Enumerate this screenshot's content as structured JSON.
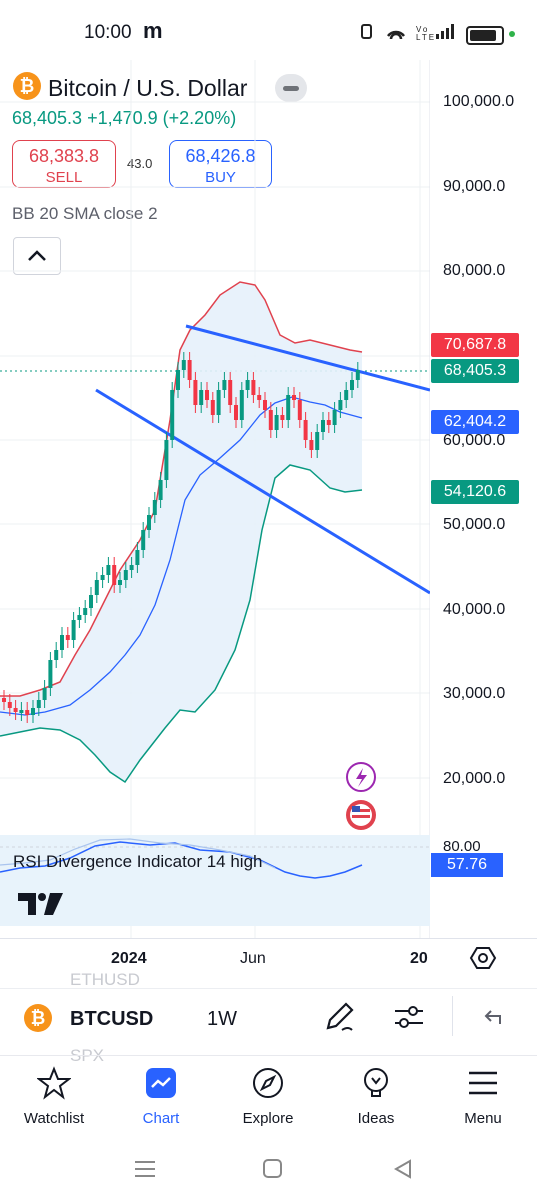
{
  "status": {
    "time": "10:00",
    "carrier_glyph": "m",
    "signal_text": "Vo LTE"
  },
  "header": {
    "coin_glyph": "₿",
    "title": "Bitcoin / U.S. Dollar",
    "last": "68,405.3",
    "change": "+1,470.9 (+2.20%)",
    "sell_price": "68,383.8",
    "sell_label": "SELL",
    "spread": "43.0",
    "buy_price": "68,426.8",
    "buy_label": "BUY",
    "indicator": "BB 20 SMA close 2"
  },
  "price_axis": [
    "100,000.0",
    "90,000.0",
    "80,000.0",
    "60,000.0",
    "50,000.0",
    "40,000.0",
    "30,000.0",
    "20,000.0"
  ],
  "price_tags": {
    "upper": "70,687.8",
    "last": "68,405.3",
    "middle": "62,404.2",
    "lower": "54,120.6"
  },
  "rsi": {
    "label": "RSI Divergence Indicator 14 high",
    "value": "57.76",
    "level": "80.00"
  },
  "time_axis": {
    "a": "2024",
    "b": "Jun",
    "c": "20"
  },
  "symbol_bar": {
    "symbol": "BTCUSD",
    "timeframe": "1W",
    "ghost_top": "ETHUSD",
    "ghost_bottom": "SPX"
  },
  "nav": [
    {
      "label": "Watchlist"
    },
    {
      "label": "Chart"
    },
    {
      "label": "Explore"
    },
    {
      "label": "Ideas"
    },
    {
      "label": "Menu"
    }
  ],
  "colors": {
    "up": "#089981",
    "down": "#f23645",
    "accent": "#2962ff",
    "band": "#e8f2fb"
  }
}
